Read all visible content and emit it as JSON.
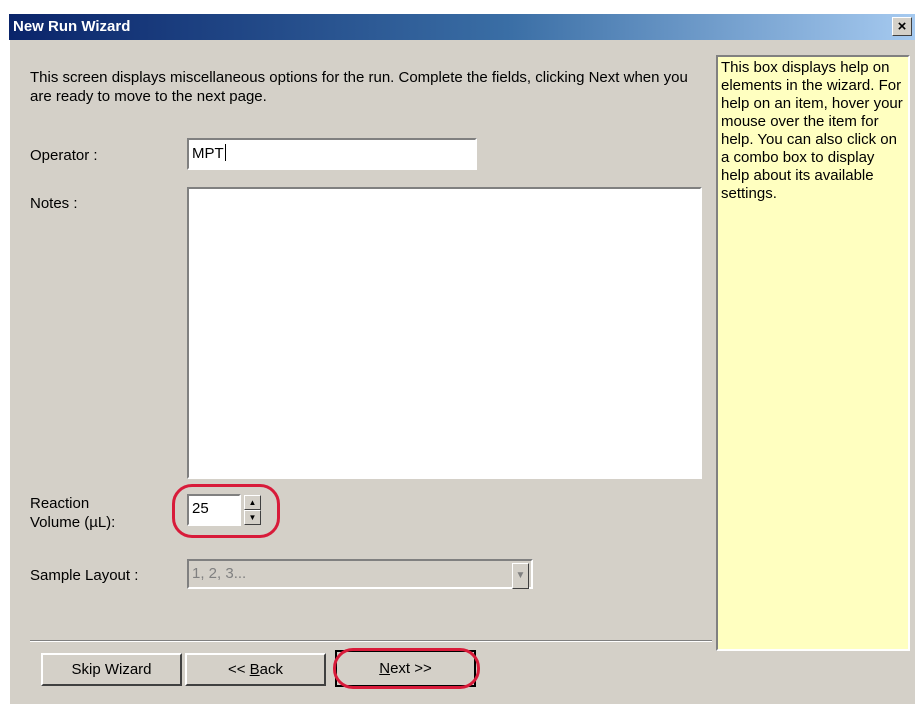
{
  "window": {
    "title": "New Run Wizard",
    "close_glyph": "×"
  },
  "intro_text": "This screen displays miscellaneous options for the run. Complete the fields, clicking Next when you are ready to move to the next page.",
  "form": {
    "operator": {
      "label": "Operator :",
      "value": "MPT"
    },
    "notes": {
      "label": "Notes :",
      "value": ""
    },
    "reaction_volume": {
      "label_line1": "Reaction",
      "label_line2": "Volume (µL):",
      "value": "25",
      "up_glyph": "▲",
      "down_glyph": "▼"
    },
    "sample_layout": {
      "label": "Sample Layout :",
      "value": "1, 2, 3...",
      "dropdown_glyph": "▼",
      "disabled": true
    }
  },
  "help_text": "This box displays help on elements in the wizard. For help on an item, hover your mouse over the item for help. You can also click on a combo box to display help about its available settings.",
  "buttons": {
    "skip": "Skip Wizard",
    "back_prefix": "<< ",
    "back_mnemonic": "B",
    "back_rest": "ack",
    "next_mnemonic": "N",
    "next_rest": "ext >>"
  },
  "colors": {
    "dialog_bg": "#d4d0c8",
    "titlebar_start": "#0a246a",
    "titlebar_end": "#a6caf0",
    "help_bg": "#ffffc0",
    "highlight_ring": "#d81b3a"
  }
}
